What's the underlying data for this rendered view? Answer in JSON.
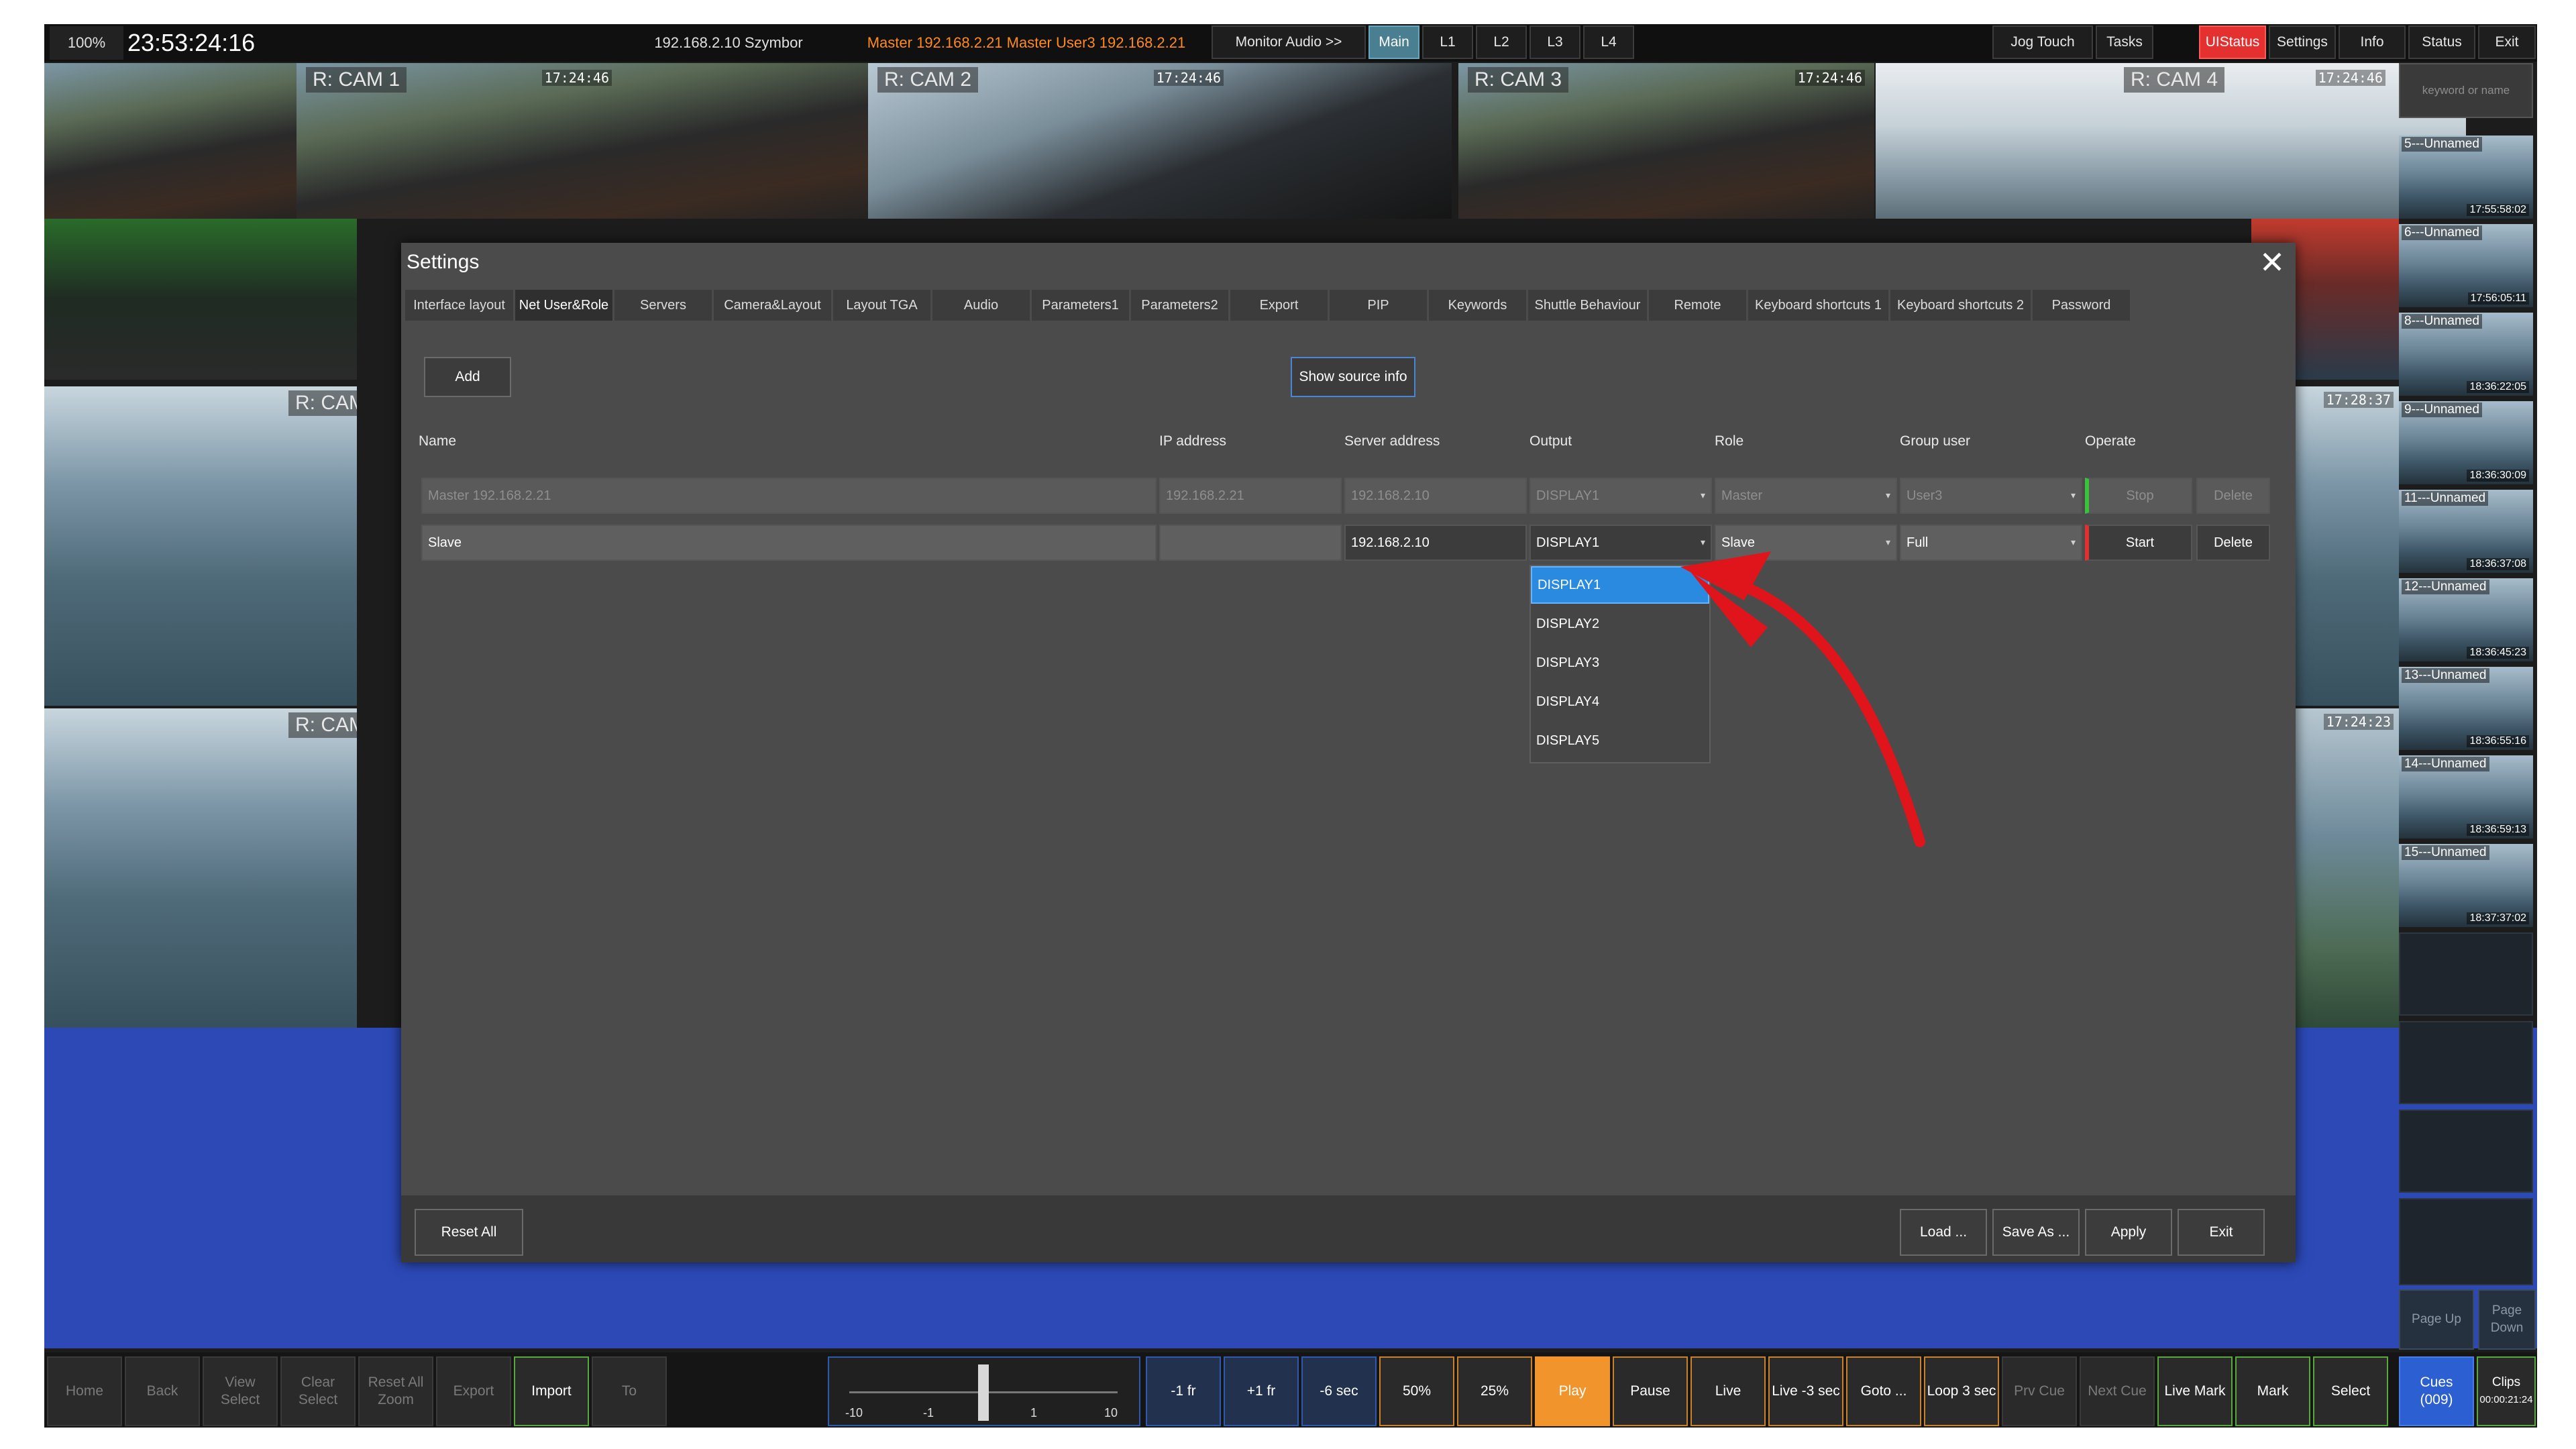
{
  "top_bar": {
    "zoom": "100%",
    "timecode": "23:53:24:16",
    "server": "192.168.2.10 Szymbor",
    "master_info": "Master 192.168.2.21  Master  User3  192.168.2.21",
    "buttons": [
      "Monitor Audio >>",
      "Main",
      "L1",
      "L2",
      "L3",
      "L4"
    ],
    "right_buttons": [
      "Jog Touch",
      "Tasks",
      "UIStatus",
      "Settings",
      "Info",
      "Status",
      "Exit"
    ]
  },
  "feeds": {
    "cam1": {
      "label": "R: CAM 1",
      "timecode": "17:24:46"
    },
    "cam2": {
      "label": "R: CAM 2",
      "timecode": "17:24:46"
    },
    "cam3": {
      "label": "R: CAM 3",
      "timecode": "17:24:46"
    },
    "cam4": {
      "label": "R: CAM 4",
      "timecode": "17:24:46"
    },
    "left_a": {
      "label": "R: CAM"
    },
    "left_b": {
      "label": "R: CAM"
    },
    "right_a": {
      "timecode": "17:28:37"
    },
    "right_b": {
      "timecode": "17:24:23"
    }
  },
  "clips": {
    "search_placeholder": "keyword or name",
    "items": [
      {
        "name": "5---Unnamed",
        "time": "17:55:58:02"
      },
      {
        "name": "6---Unnamed",
        "time": "17:56:05:11"
      },
      {
        "name": "8---Unnamed",
        "time": "18:36:22:05"
      },
      {
        "name": "9---Unnamed",
        "time": "18:36:30:09"
      },
      {
        "name": "11---Unnamed",
        "time": "18:36:37:08"
      },
      {
        "name": "12---Unnamed",
        "time": "18:36:45:23"
      },
      {
        "name": "13---Unnamed",
        "time": "18:36:55:16"
      },
      {
        "name": "14---Unnamed",
        "time": "18:36:59:13"
      },
      {
        "name": "15---Unnamed",
        "time": "18:37:37:02"
      }
    ],
    "page_up": "Page Up",
    "page_down": "Page Down"
  },
  "settings": {
    "title": "Settings",
    "tabs": [
      "Interface layout",
      "Net User&Role",
      "Servers",
      "Camera&Layout",
      "Layout TGA",
      "Audio",
      "Parameters1",
      "Parameters2",
      "Export",
      "PIP",
      "Keywords",
      "Shuttle Behaviour",
      "Remote",
      "Keyboard shortcuts 1",
      "Keyboard shortcuts 2",
      "Password"
    ],
    "add_label": "Add",
    "show_source_info": "Show source info",
    "columns": {
      "name": "Name",
      "ip": "IP address",
      "server": "Server address",
      "output": "Output",
      "role": "Role",
      "group": "Group user",
      "operate": "Operate"
    },
    "rows": [
      {
        "name": "Master 192.168.2.21",
        "ip": "192.168.2.21",
        "server": "192.168.2.10",
        "output": "DISPLAY1",
        "role": "Master",
        "group": "User3",
        "action": "Stop",
        "delete": "Delete"
      },
      {
        "name": "Slave",
        "ip": "",
        "server": "192.168.2.10",
        "output": "DISPLAY1",
        "role": "Slave",
        "group": "Full",
        "action": "Start",
        "delete": "Delete"
      }
    ],
    "output_options": [
      "DISPLAY1",
      "DISPLAY2",
      "DISPLAY3",
      "DISPLAY4",
      "DISPLAY5"
    ],
    "footer": {
      "reset_all": "Reset All",
      "load": "Load ...",
      "save_as": "Save As ...",
      "apply": "Apply",
      "exit": "Exit"
    }
  },
  "bottom_bar": {
    "buttons": [
      "Home",
      "Back",
      "View Select",
      "Clear Select",
      "Reset All Zoom",
      "Export",
      "Import",
      "To"
    ],
    "jog_ticks": [
      "-10",
      "-1",
      "1",
      "10"
    ],
    "transport": [
      "-1 fr",
      "+1 fr",
      "-6 sec",
      "50%",
      "25%",
      "Play",
      "Pause",
      "Live",
      "Live -3 sec",
      "Goto ...",
      "Loop 3 sec",
      "Prv Cue",
      "Next Cue",
      "Live Mark",
      "Mark",
      "Select"
    ],
    "cues_label": "Cues",
    "cues_count": "(009)",
    "clips_label": "Clips",
    "clips_time": "00:00:21:24"
  },
  "colors": {
    "accent_red": "#e53030",
    "selected_blue": "#2a8ae0",
    "play_orange": "#f0942b",
    "annotation_arrow": "#e0141b"
  }
}
